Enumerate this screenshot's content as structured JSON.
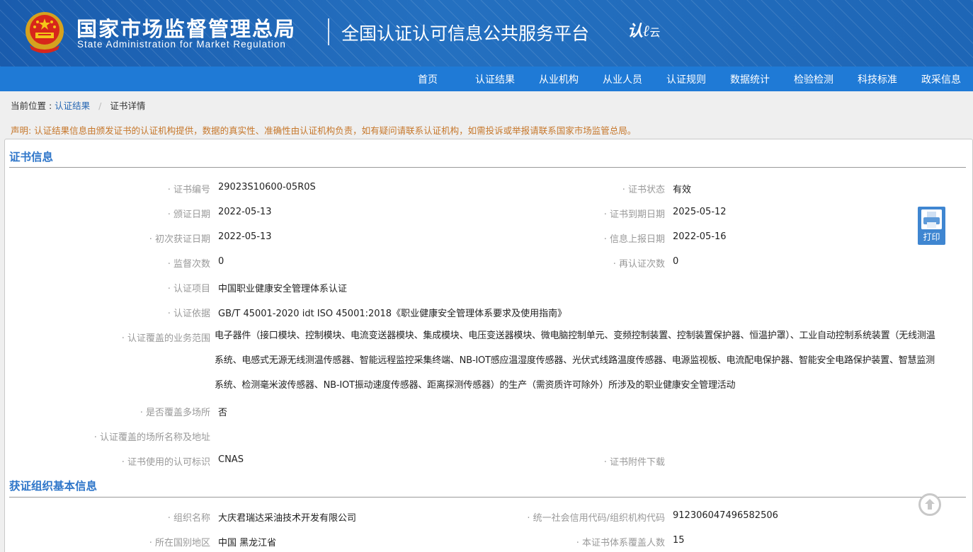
{
  "header": {
    "title_cn": "国家市场监督管理总局",
    "title_en": "State Administration  for  Market Regulation",
    "platform": "全国认证认可信息公共服务平台",
    "logo_text": "认",
    "logo_sub": "云"
  },
  "nav": {
    "items": [
      "首页",
      "认证结果",
      "从业机构",
      "从业人员",
      "认证规则",
      "数据统计",
      "检验检测",
      "科技标准",
      "政采信息"
    ]
  },
  "breadcrumb": {
    "prefix": "当前位置 :",
    "link": "认证结果",
    "current": "证书详情"
  },
  "notice": "声明: 认证结果信息由颁发证书的认证机构提供，数据的真实性、准确性由认证机构负责，如有疑问请联系认证机构，如需投诉或举报请联系国家市场监管总局。",
  "cert_section": {
    "title": "证书信息",
    "fields": {
      "cert_no": {
        "label": "证书编号",
        "value": "29023S10600-05R0S"
      },
      "status": {
        "label": "证书状态",
        "value": "有效"
      },
      "issue_date": {
        "label": "颁证日期",
        "value": "2022-05-13"
      },
      "expiry_date": {
        "label": "证书到期日期",
        "value": "2025-05-12"
      },
      "first_date": {
        "label": "初次获证日期",
        "value": "2022-05-13"
      },
      "report_date": {
        "label": "信息上报日期",
        "value": "2022-05-16"
      },
      "supervision_count": {
        "label": "监督次数",
        "value": "0"
      },
      "recert_count": {
        "label": "再认证次数",
        "value": "0"
      },
      "project": {
        "label": "认证项目",
        "value": "中国职业健康安全管理体系认证"
      },
      "basis": {
        "label": "认证依据",
        "value": "GB/T 45001-2020 idt ISO 45001:2018《职业健康安全管理体系要求及使用指南》"
      },
      "scope": {
        "label": "认证覆盖的业务范围",
        "value": "电子器件（接口模块、控制模块、电流变送器模块、集成模块、电压变送器模块、微电脑控制单元、变频控制装置、控制装置保护器、恒温护罩）、工业自动控制系统装置（无线测温系统、电感式无源无线测温传感器、智能远程监控采集终端、NB-IOT感应温湿度传感器、光伏式线路温度传感器、电源监视板、电流配电保护器、智能安全电路保护装置、智慧监测系统、检测毫米波传感器、NB-IOT振动速度传感器、距离探测传感器）的生产（需资质许可除外）所涉及的职业健康安全管理活动"
      },
      "multi_site": {
        "label": "是否覆盖多场所",
        "value": "否"
      },
      "site_name_addr": {
        "label": "认证覆盖的场所名称及地址",
        "value": ""
      },
      "accreditation_mark": {
        "label": "证书使用的认可标识",
        "value": "CNAS"
      },
      "attachment": {
        "label": "证书附件下载",
        "value": ""
      }
    }
  },
  "org_section": {
    "title": "获证组织基本信息",
    "fields": {
      "org_name": {
        "label": "组织名称",
        "value": "大庆君瑞达采油技术开发有限公司"
      },
      "credit_code": {
        "label": "统一社会信用代码/组织机构代码",
        "value": "912306047496582506"
      },
      "region": {
        "label": "所在国别地区",
        "value": "中国 黑龙江省"
      },
      "covered_people": {
        "label": "本证书体系覆盖人数",
        "value": "15"
      }
    }
  },
  "print_label": "打印",
  "icons": {
    "print": "printer-icon",
    "scroll_top": "arrow-up-circle-icon",
    "emblem": "national-emblem-icon"
  },
  "colors": {
    "header": "#1e68b8",
    "nav": "#1f7ad6",
    "section_title": "#2f76c9",
    "notice": "#c6772b",
    "link": "#2767b3"
  }
}
